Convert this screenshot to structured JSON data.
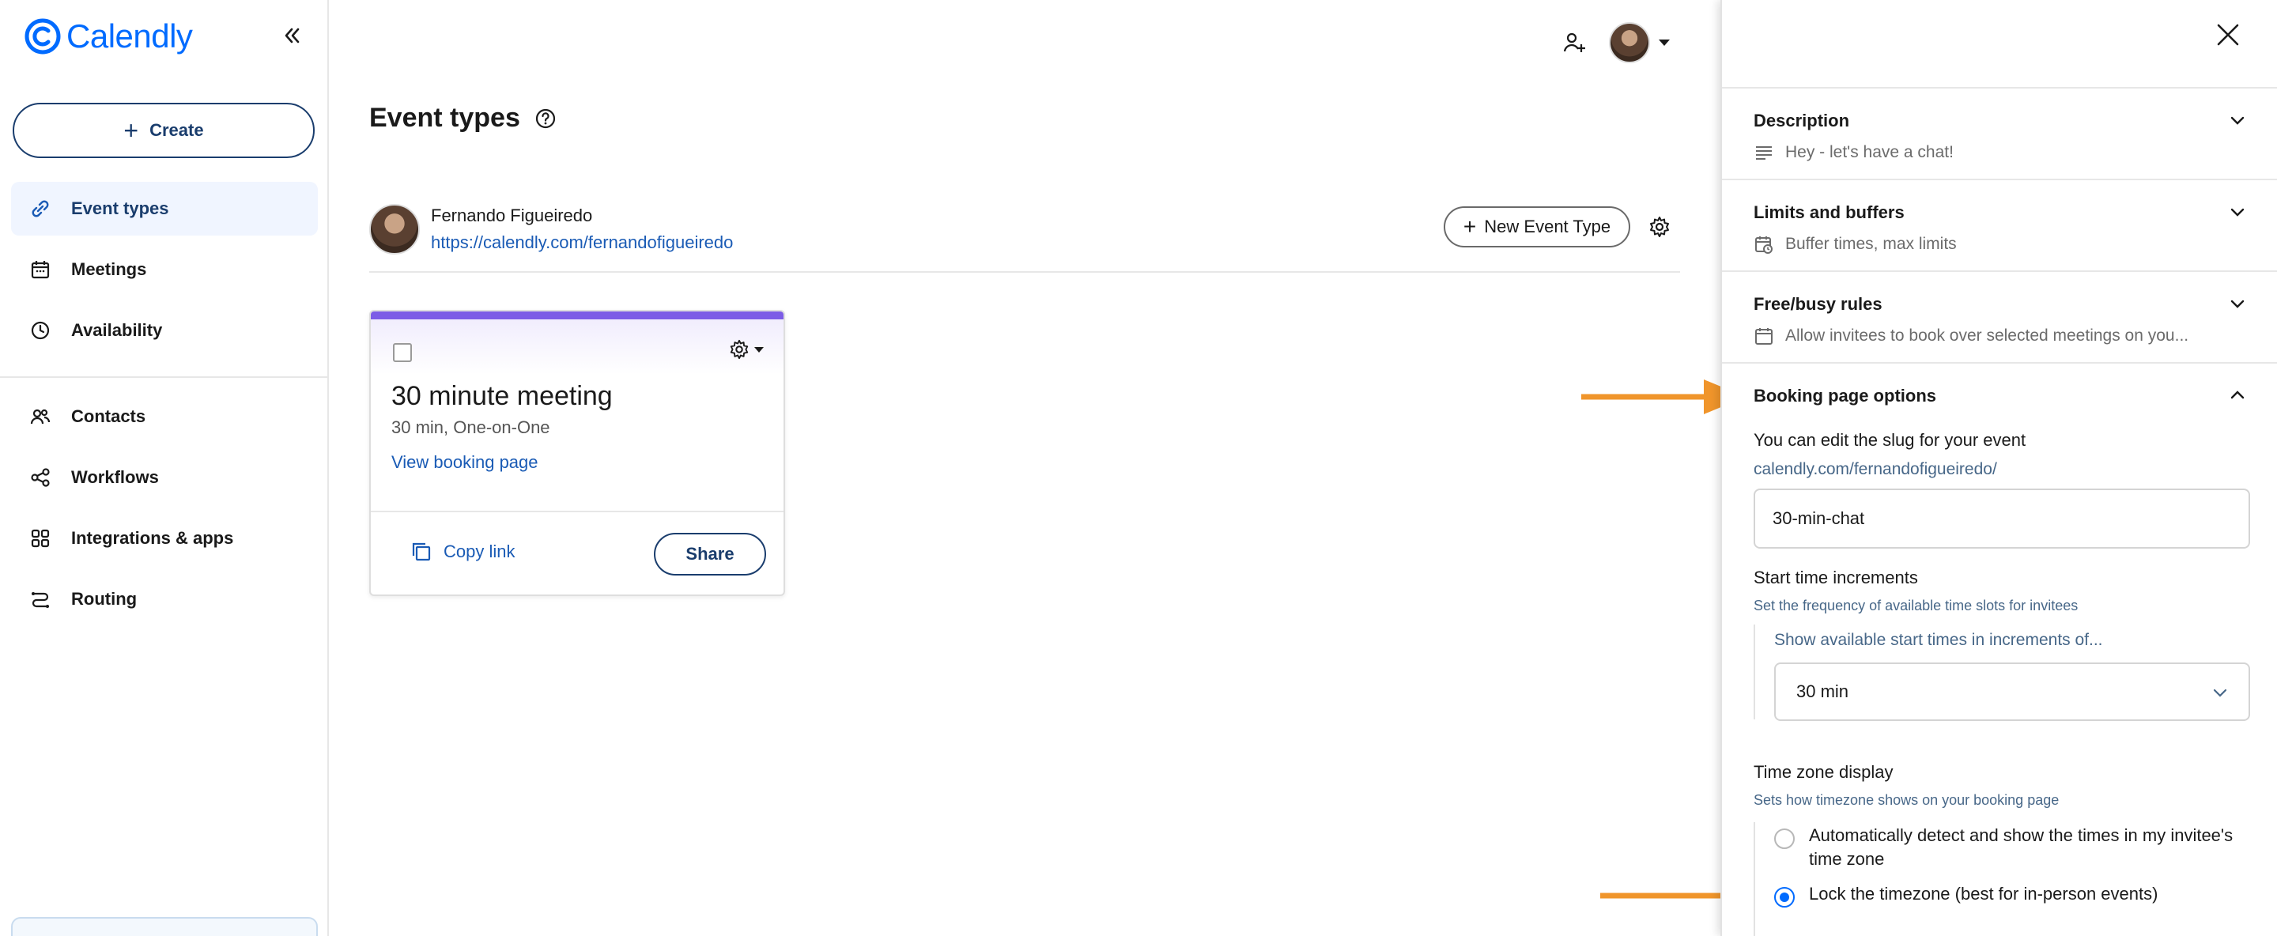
{
  "app": {
    "logo_text": "Calendly",
    "brand_color": "#006bff"
  },
  "sidebar": {
    "create_label": "Create",
    "items": [
      {
        "label": "Event types",
        "icon": "link-icon",
        "active": true
      },
      {
        "label": "Meetings",
        "icon": "calendar-icon"
      },
      {
        "label": "Availability",
        "icon": "clock-icon"
      },
      {
        "label": "Contacts",
        "icon": "contacts-icon"
      },
      {
        "label": "Workflows",
        "icon": "workflow-icon"
      },
      {
        "label": "Integrations & apps",
        "icon": "apps-grid-icon"
      },
      {
        "label": "Routing",
        "icon": "routing-icon"
      }
    ]
  },
  "main": {
    "title": "Event types",
    "user": {
      "name": "Fernando Figueiredo",
      "link": "https://calendly.com/fernandofigueiredo"
    },
    "new_event_label": "New Event Type",
    "card": {
      "title": "30 minute meeting",
      "subtitle": "30 min, One-on-One",
      "view_link": "View booking page",
      "copy_link": "Copy link",
      "share": "Share",
      "accent_color": "#7c5ce6"
    }
  },
  "panel": {
    "sections": [
      {
        "title": "Description",
        "desc": "Hey - let's have a chat!",
        "icon": "text-lines-icon"
      },
      {
        "title": "Limits and buffers",
        "desc": "Buffer times, max limits",
        "icon": "calendar-clock-icon"
      },
      {
        "title": "Free/busy rules",
        "desc": "Allow invitees to book over selected meetings on you...",
        "icon": "calendar-icon"
      }
    ],
    "booking": {
      "title": "Booking page options",
      "slug_label": "You can edit the slug for your event",
      "slug_url": "calendly.com/fernandofigueiredo/",
      "slug_value": "30-min-chat",
      "increments_label": "Start time increments",
      "increments_help": "Set the frequency of available time slots for invitees",
      "increments_sub": "Show available start times in increments of...",
      "increments_value": "30 min",
      "tz_label": "Time zone display",
      "tz_help": "Sets how timezone shows on your booking page",
      "tz_options": [
        {
          "label": "Automatically detect and show the times in my invitee's time zone",
          "selected": false
        },
        {
          "label": "Lock the timezone (best for in-person events)",
          "selected": true
        }
      ]
    }
  },
  "annotation_color": "#f0952b"
}
